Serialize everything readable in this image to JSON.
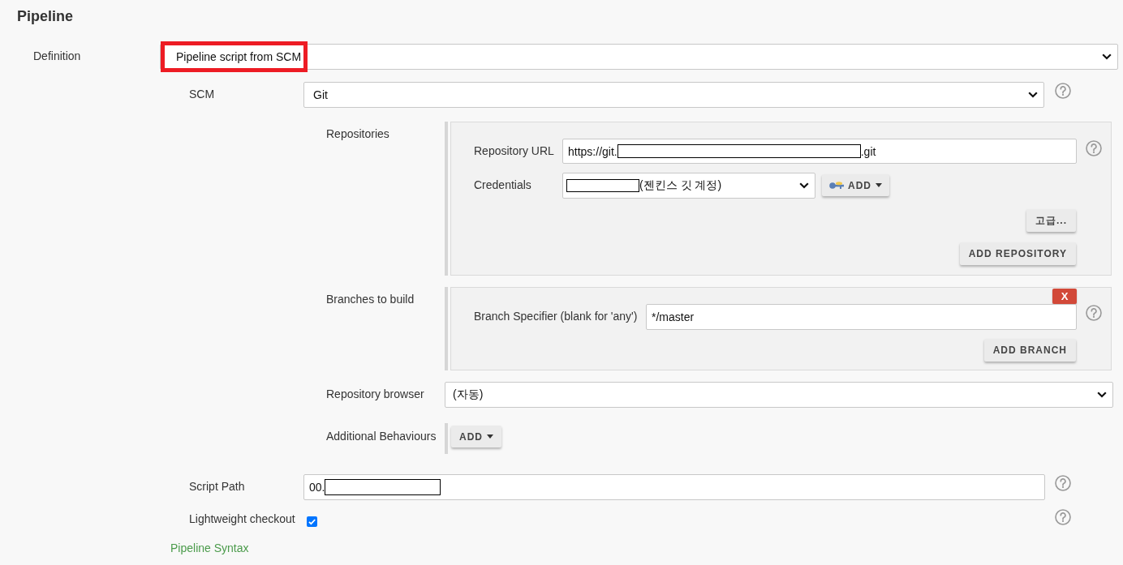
{
  "section_title": "Pipeline",
  "definition": {
    "label": "Definition",
    "value": "Pipeline script from SCM",
    "highlighted": true
  },
  "scm": {
    "label": "SCM",
    "value": "Git"
  },
  "repositories": {
    "label": "Repositories",
    "url": {
      "label": "Repository URL",
      "value": [
        {
          "kind": "text",
          "text": "https://git."
        },
        {
          "kind": "redacted"
        },
        {
          "kind": "text",
          "text": ".git"
        }
      ]
    },
    "credentials": {
      "label": "Credentials",
      "value": [
        {
          "kind": "redacted"
        },
        {
          "kind": "text",
          "text": "(젠킨스 깃 계정)"
        }
      ],
      "add_button": "ADD"
    },
    "advanced_button": "고급...",
    "add_repository_button": "ADD REPOSITORY"
  },
  "branches": {
    "label": "Branches to build",
    "delete_button": "X",
    "specifier": {
      "label": "Branch Specifier (blank for 'any')",
      "value": "*/master"
    },
    "add_branch_button": "ADD BRANCH"
  },
  "repository_browser": {
    "label": "Repository browser",
    "value": "(자동)"
  },
  "additional_behaviours": {
    "label": "Additional Behaviours",
    "add_button": "ADD"
  },
  "script_path": {
    "label": "Script Path",
    "value": [
      {
        "kind": "text",
        "text": "00."
      },
      {
        "kind": "redacted"
      }
    ]
  },
  "lightweight_checkout": {
    "label": "Lightweight checkout",
    "checked": true
  },
  "pipeline_syntax_link": "Pipeline Syntax"
}
